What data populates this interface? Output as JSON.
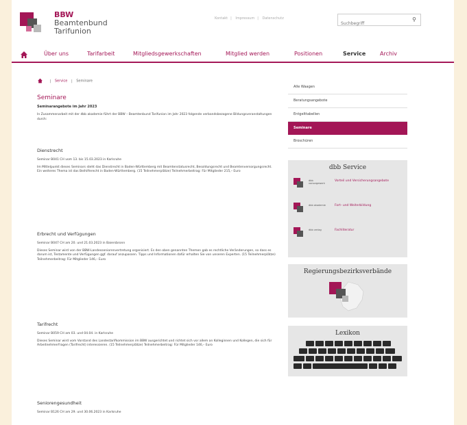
{
  "header": {
    "brand_line1": "BBW",
    "brand_line2": "Beamtenbund",
    "brand_line3": "Tarifunion",
    "top_links": [
      "Kontakt",
      "Impressum",
      "Datenschutz"
    ],
    "search_placeholder": "Suchbegriff"
  },
  "nav": {
    "items": [
      "Über uns",
      "Tarifarbeit",
      "Mitgliedsgewerkschaften",
      "Mitglied werden",
      "Positionen",
      "Service",
      "Archiv"
    ]
  },
  "breadcrumb": {
    "items": [
      "Service",
      "Seminare"
    ]
  },
  "main": {
    "title": "Seminare",
    "subtitle": "Seminarangebote im Jahr 2023",
    "intro": "In Zusammenarbeit mit der dbb akademie führt der BBW – Beamtenbund Tarifunion im Jahr 2023 folgende verbandsbezogene Bildungsveranstaltungen durch:",
    "sections": [
      {
        "heading": "Dienstrecht",
        "meta": "Seminar B041 CH vom 13. bis 15.03.2023 in Karlsruhe",
        "body": "Im Mittelpunkt dieses Seminars steht das Dienstrecht in Baden-Württemberg mit Beamtenstatusrecht, Besoldungsrecht und Beamtenversorgungsrecht. Ein weiteres Thema ist das Beihilferecht in Baden-Württemberg. (15 Teilnehmerplätze) Teilnehmerbeitrag: Für Mitglieder 215,– Euro"
      },
      {
        "heading": "Erbrecht und Verfügungen",
        "meta": "Seminar B047 CH am 20. und 21.03.2023 in Baiersbronn",
        "body": "Dieses Seminar wird von der BBW-Landesseniorenvertretung organisiert. Es den oben genannten Themen gab es rechtliche Veränderungen, so dass es darum ist, Testamente und Verfügungen ggf. darauf anzupassen. Tipps und Informationen dafür erhalten Sie von unseren Experten. (15 Teilnehmerplätze) Teilnehmerbeitrag: Für Mitglieder 146,– Euro"
      },
      {
        "heading": "Tarifrecht",
        "meta": "Seminar B059 CH am 03. und 04.04. in Karlsruhe",
        "body": "Dieses Seminar wird vom Vorstand des Landestarifkommission im BBW ausgerichtet und richtet sich vor allem an Kolleginnen und Kollegen, die sich für Arbeitnehmerfragen (Tarifrecht) interessieren. (15 Teilnehmerplätze) Teilnehmerbeitrag: Für Mitglieder 146,– Euro"
      },
      {
        "heading": "Seniorengesundheit",
        "meta": "Seminar B126 CH am 29. und 30.06.2023 in Karlsruhe",
        "body": ""
      }
    ]
  },
  "sidebar": {
    "items": [
      "Alle Waagen",
      "Beratungsangebote",
      "Entgelttabellen",
      "Seminare",
      "Broschüren"
    ],
    "active_index": 3,
    "service_title": "dbb Service",
    "service_rows": [
      {
        "mini": "dbb vorsorgewerk",
        "link": "Vorteil und Versicherungsangebote"
      },
      {
        "mini": "dbb akademie",
        "link": "Fort- und Weiterbildung"
      },
      {
        "mini": "dbb verlag",
        "link": "Fachliteratur"
      }
    ],
    "region_title": "Regierungsbezirksverbände",
    "lexikon_title": "Lexikon"
  },
  "colors": {
    "accent": "#a31656"
  }
}
